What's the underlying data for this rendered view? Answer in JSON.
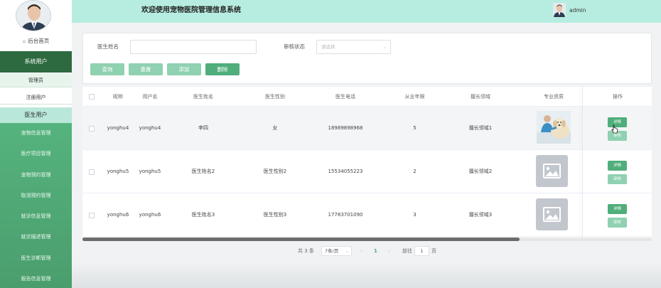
{
  "header": {
    "title": "欢迎使用宠物医院管理信息系统",
    "username": "admin"
  },
  "sidebar": {
    "home": "后台首页",
    "group_title": "系统用户",
    "sub_items": [
      "管理员",
      "注册用户"
    ],
    "group_title2": "医生用户",
    "menu": [
      "宠物信息管理",
      "医疗项目管理",
      "宠物预约管理",
      "取消预约管理",
      "就诊信息管理",
      "就诊描述管理",
      "医生诊断管理",
      "报告信息管理"
    ]
  },
  "search": {
    "doctor_name_label": "医生姓名",
    "doctor_name_value": "",
    "audit_label": "审核状态",
    "audit_placeholder": "请选择",
    "buttons": {
      "query": "查询",
      "reset": "重置",
      "add": "添加",
      "delete": "删除"
    }
  },
  "table": {
    "columns": [
      "昵称",
      "用户名",
      "医生姓名",
      "医生性别",
      "医生电话",
      "从业年限",
      "擅长领域",
      "专业资质",
      "操作"
    ],
    "rows": [
      {
        "nickname": "yonghu4",
        "username": "yonghu4",
        "name": "李四",
        "gender": "女",
        "phone": "18989898968",
        "years": "5",
        "field": "擅长领域1",
        "photo": "dog-vet-photo"
      },
      {
        "nickname": "yonghu5",
        "username": "yonghu5",
        "name": "医生姓名2",
        "gender": "医生性别2",
        "phone": "15534055223",
        "years": "2",
        "field": "擅长领域2",
        "photo": "image-placeholder-icon"
      },
      {
        "nickname": "yonghu6",
        "username": "yonghu6",
        "name": "医生姓名3",
        "gender": "医生性别3",
        "phone": "17783701090",
        "years": "3",
        "field": "擅长领域3",
        "photo": "image-placeholder-icon"
      }
    ],
    "op_detail": "详情",
    "op_audit": "审核"
  },
  "pagination": {
    "total": "共 3 条",
    "page_size": "7条/页",
    "current": "1",
    "goto_label": "前往",
    "goto_value": "1",
    "page_suffix": "页"
  },
  "colors": {
    "primary": "#4fae7b",
    "primary_light": "#8fd1b0",
    "header_bg": "#b7ede0",
    "sidebar_dark": "#2d6a40"
  }
}
